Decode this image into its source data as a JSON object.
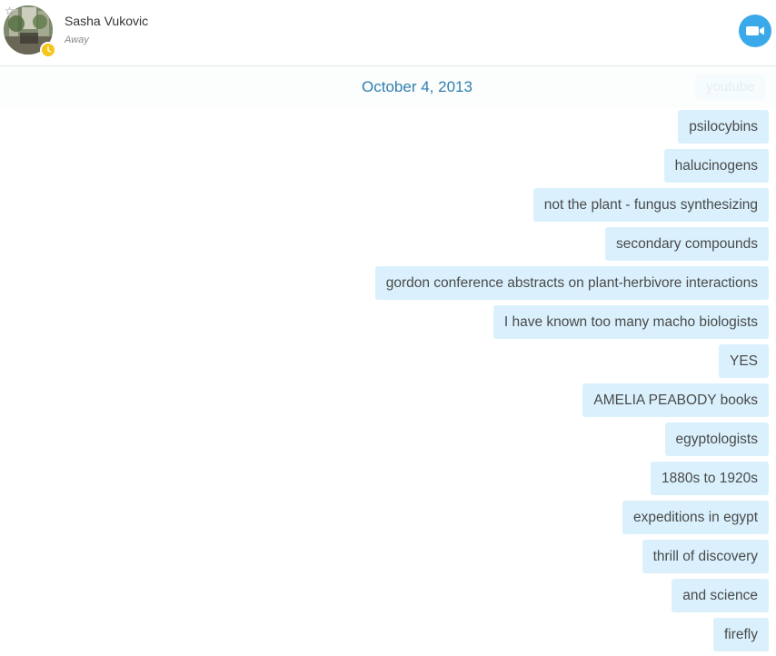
{
  "contact": {
    "name": "Sasha Vukovic",
    "status": "Away"
  },
  "colors": {
    "accent": "#3aa9ea",
    "bubble": "#daf1fd",
    "date": "#2f7fb0",
    "status_away": "#f5c518"
  },
  "icons": {
    "favorite": "star-outline-icon",
    "status": "clock-icon",
    "video": "video-camera-icon"
  },
  "conversation": {
    "date": "October 4, 2013",
    "faded_message": "youtube",
    "messages": [
      "psilocybins",
      "halucinogens",
      "not the plant - fungus synthesizing",
      "secondary compounds",
      "gordon conference abstracts on plant-herbivore interactions",
      "I have known too many macho biologists",
      "YES",
      "AMELIA PEABODY books",
      "egyptologists",
      "1880s to 1920s",
      "expeditions in egypt",
      "thrill of discovery",
      "and science",
      "firefly"
    ]
  }
}
